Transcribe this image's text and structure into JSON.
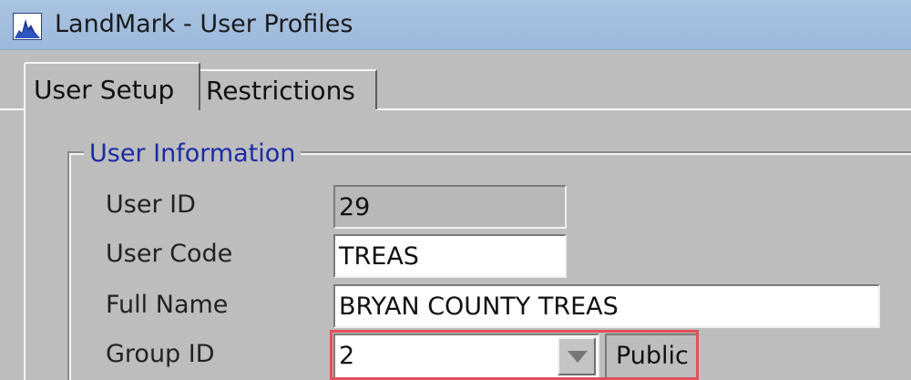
{
  "window": {
    "title": "LandMark - User Profiles",
    "icon": "landmark-app-icon"
  },
  "tabs": [
    {
      "label": "User Setup",
      "selected": true
    },
    {
      "label": "Restrictions",
      "selected": false
    }
  ],
  "user_information": {
    "legend": "User Information",
    "legend_color": "#1a2aa6",
    "fields": {
      "user_id": {
        "label": "User ID",
        "value": "29",
        "readonly": true
      },
      "user_code": {
        "label": "User Code",
        "value": "TREAS"
      },
      "full_name": {
        "label": "Full Name",
        "value": "BRYAN COUNTY TREAS"
      },
      "group_id": {
        "label": "Group ID",
        "value": "2",
        "group_name": "Public",
        "dropdown_icon": "chevron-down-icon"
      }
    }
  },
  "highlight_color": "#e0505a"
}
